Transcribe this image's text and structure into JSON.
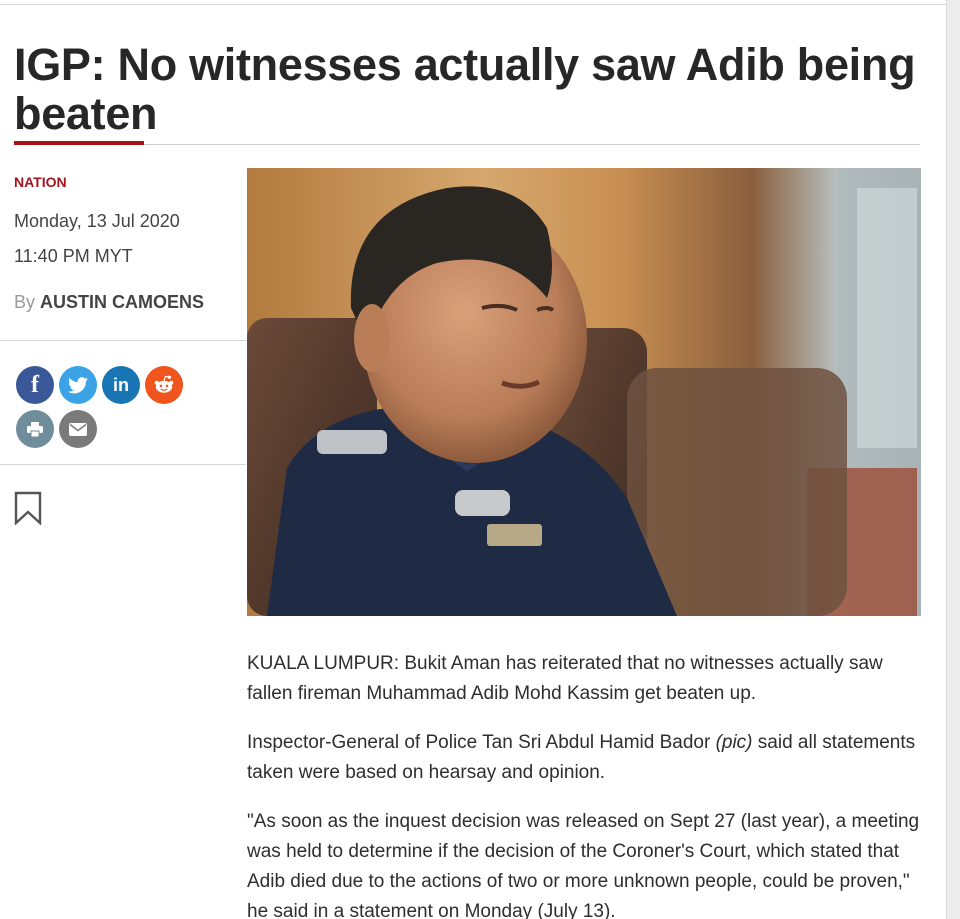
{
  "article": {
    "headline": "IGP: No witnesses actually saw Adib being beaten",
    "category": "NATION",
    "date": "Monday, 13 Jul 2020",
    "time": "11:40 PM MYT",
    "byline_prefix": "By",
    "author": "AUSTIN CAMOENS",
    "paragraphs": [
      "KUALA LUMPUR: Bukit Aman has reiterated that no witnesses actually saw fallen fireman Muhammad Adib Mohd Kassim get beaten up.",
      "\"As soon as the inquest decision was released on Sept 27 (last year), a meeting was held to determine if the decision of the Coroner's Court, which stated that Adib died due to the actions of two or more unknown people, could be proven,\" he said in a statement on Monday (July 13)."
    ],
    "paragraph2": {
      "before": "Inspector-General of Police Tan Sri Abdul Hamid Bador ",
      "italic": "(pic)",
      "after": " said all statements taken were based on hearsay and opinion."
    }
  },
  "share": {
    "facebook": "f",
    "linkedin": "in"
  },
  "icons": {
    "facebook": "facebook-icon",
    "twitter": "twitter-icon",
    "linkedin": "linkedin-icon",
    "reddit": "reddit-icon",
    "print": "print-icon",
    "email": "email-icon",
    "bookmark": "bookmark-icon"
  },
  "colors": {
    "accent": "#a8121c",
    "facebook": "#3a5897",
    "twitter": "#3aa2e5",
    "linkedin": "#1a75b4",
    "reddit": "#f0551e",
    "print": "#6f8d9a",
    "email": "#7a7a7a"
  }
}
